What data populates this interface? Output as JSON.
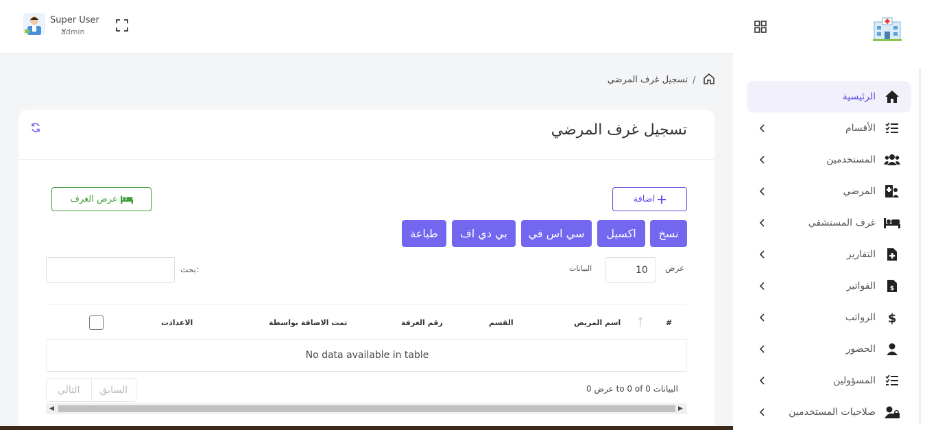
{
  "header": {
    "user_name": "Super User",
    "user_role": "admin"
  },
  "sidebar": {
    "items": [
      {
        "label": "الرئيسية",
        "icon": "home-icon"
      },
      {
        "label": "الأقسام",
        "icon": "list-check-icon"
      },
      {
        "label": "المستخدمين",
        "icon": "users-icon"
      },
      {
        "label": "المرضي",
        "icon": "patient-icon"
      },
      {
        "label": "غرف المستشفي",
        "icon": "bed-icon"
      },
      {
        "label": "التقارير",
        "icon": "file-medical-icon"
      },
      {
        "label": "الفواتير",
        "icon": "file-invoice-icon"
      },
      {
        "label": "الرواتب",
        "icon": "dollar-icon"
      },
      {
        "label": "الحضور",
        "icon": "user-icon"
      },
      {
        "label": "المسؤولين",
        "icon": "list-check-icon"
      },
      {
        "label": "صلاحيات المستخدمين",
        "icon": "user-lock-icon"
      }
    ]
  },
  "breadcrumb": {
    "separator": "/",
    "current": "تسجيل غرف المرضي"
  },
  "card": {
    "title": "تسجيل غرف المرضي",
    "add_button": "اضافة",
    "rooms_button": "عرض الغرف",
    "export_buttons": [
      "نسخ",
      "اكسيل",
      "سي اس في",
      "بي دي اف",
      "طباعة"
    ],
    "length_label": "عرض",
    "length_value": "10",
    "length_unit": "البيانات",
    "search_label": "بحث:",
    "columns": [
      "#",
      "اسم المريض",
      "القسم",
      "رقم الغرفة",
      "تمت الاضافة بواسطة",
      "الاعدادت"
    ],
    "empty_text": "No data available in table",
    "info_text": "عرض 0 to 0 of 0 البيانات",
    "prev": "السابق",
    "next": "التالي"
  },
  "colors": {
    "accent": "#7367f0",
    "green": "#3d9b38"
  }
}
